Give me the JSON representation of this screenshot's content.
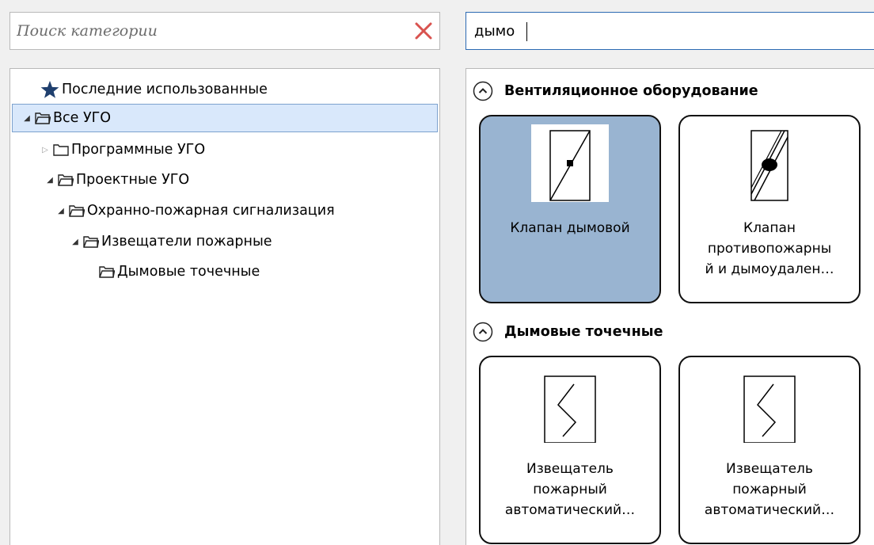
{
  "left_search": {
    "placeholder": "Поиск категории",
    "value": "",
    "clear_icon": "close-x-icon"
  },
  "right_search": {
    "value": "дымо"
  },
  "tree": {
    "items": [
      {
        "label": "Последние использованные",
        "icon": "star-icon",
        "arrow": ""
      },
      {
        "label": "Все УГО",
        "icon": "folder-open-icon",
        "arrow": "expanded",
        "selected": true
      },
      {
        "label": "Программные УГО",
        "icon": "folder-closed-icon",
        "arrow": "collapsed"
      },
      {
        "label": "Проектные УГО",
        "icon": "folder-open-icon",
        "arrow": "expanded"
      },
      {
        "label": "Охранно-пожарная сигнализация",
        "icon": "folder-open-icon",
        "arrow": "expanded"
      },
      {
        "label": "Извещатели пожарные",
        "icon": "folder-open-icon",
        "arrow": "expanded"
      },
      {
        "label": "Дымовые точечные",
        "icon": "folder-open-icon",
        "arrow": ""
      }
    ]
  },
  "results": {
    "groups": [
      {
        "title": "Вентиляционное оборудование",
        "cards": [
          {
            "label": "Клапан дымовой",
            "selected": true,
            "icon": "smoke-valve-symbol"
          },
          {
            "label": "Клапан\nпротивопожарны\nй и дымоудален…",
            "selected": false,
            "icon": "fire-smoke-valve-symbol"
          }
        ]
      },
      {
        "title": "Дымовые точечные",
        "cards": [
          {
            "label": "Извещатель\nпожарный\nавтоматический…",
            "selected": false,
            "icon": "smoke-detector-symbol"
          },
          {
            "label": "Извещатель\nпожарный\nавтоматический…",
            "selected": false,
            "icon": "smoke-detector-symbol"
          }
        ]
      }
    ]
  },
  "colors": {
    "selection_bg": "#d9e8fb",
    "selection_border": "#7da2ce",
    "card_selected_bg": "#99b4d1",
    "clear_icon": "#d9534f",
    "focus_border": "#2c6ab3"
  }
}
